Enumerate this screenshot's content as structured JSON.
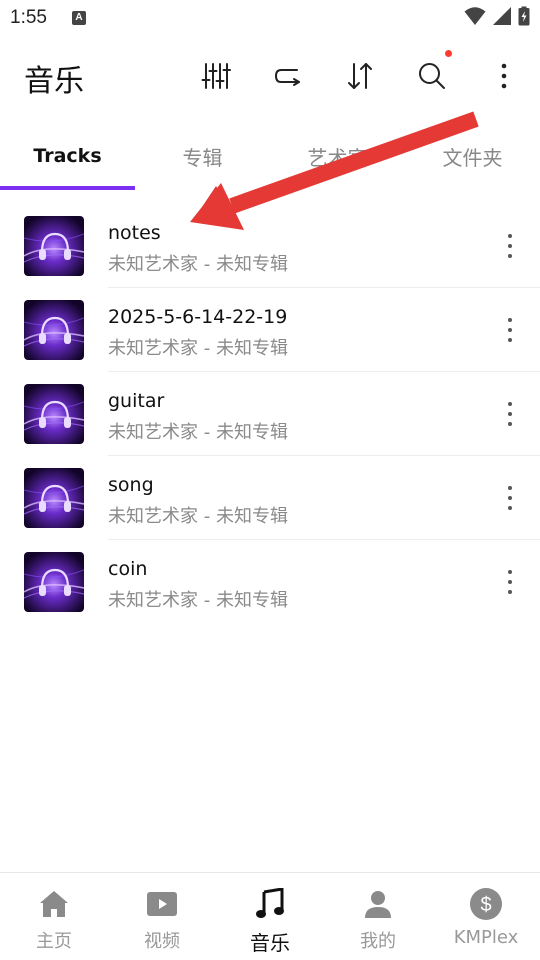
{
  "status_bar": {
    "time": "1:55",
    "badge": "A"
  },
  "app_bar": {
    "title": "音乐"
  },
  "tabs": [
    {
      "label": "Tracks",
      "active": true
    },
    {
      "label": "专辑",
      "active": false
    },
    {
      "label": "艺术家",
      "active": false
    },
    {
      "label": "文件夹",
      "active": false
    }
  ],
  "tracks": [
    {
      "title": "notes",
      "subtitle": "未知艺术家 - 未知专辑"
    },
    {
      "title": "2025-5-6-14-22-19",
      "subtitle": "未知艺术家 - 未知专辑"
    },
    {
      "title": "guitar",
      "subtitle": "未知艺术家 - 未知专辑"
    },
    {
      "title": "song",
      "subtitle": "未知艺术家 - 未知专辑"
    },
    {
      "title": "coin",
      "subtitle": "未知艺术家 - 未知专辑"
    }
  ],
  "bottom_nav": [
    {
      "label": "主页",
      "icon": "home-icon",
      "active": false
    },
    {
      "label": "视频",
      "icon": "video-icon",
      "active": false
    },
    {
      "label": "音乐",
      "icon": "music-note-icon",
      "active": true
    },
    {
      "label": "我的",
      "icon": "person-icon",
      "active": false
    },
    {
      "label": "KMPlex",
      "icon": "dollar-circle-icon",
      "active": false
    }
  ],
  "colors": {
    "accent": "#7b2ff0",
    "annotation_arrow": "#e53935",
    "notification_dot": "#ff3b30",
    "inactive_text": "#888888"
  }
}
